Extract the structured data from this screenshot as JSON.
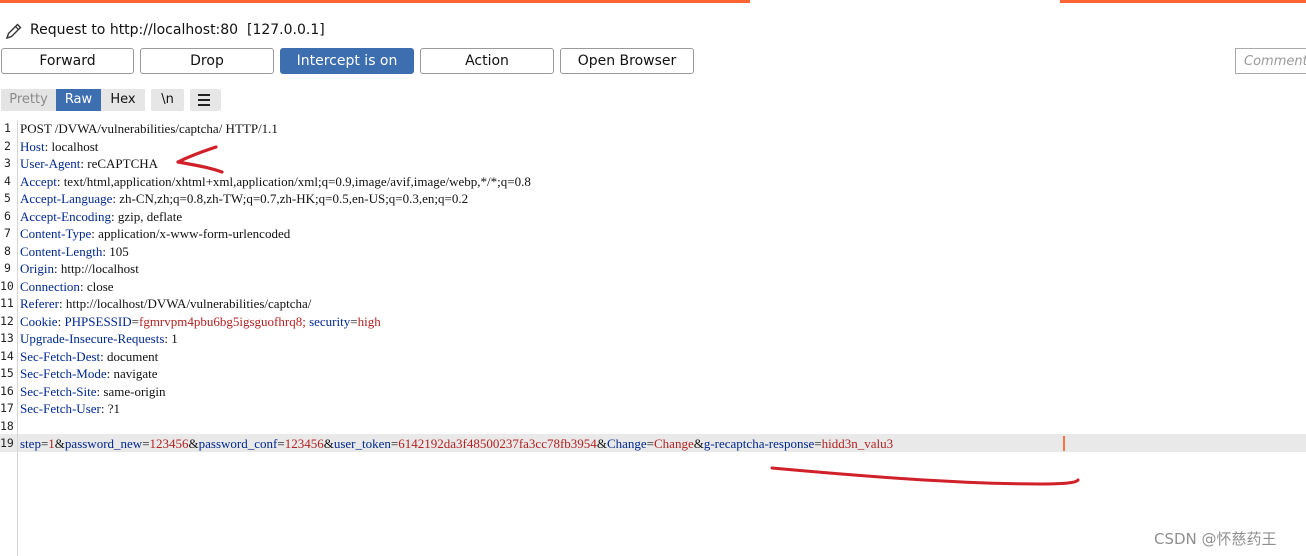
{
  "title": "Request to http://localhost:80  [127.0.0.1]",
  "toolbar": {
    "buttons": [
      "Forward",
      "Drop",
      "Intercept is on",
      "Action",
      "Open Browser"
    ],
    "active_button": "Intercept is on",
    "comment_placeholder": "Comment"
  },
  "view_tabs": {
    "pretty": "Pretty",
    "raw": "Raw",
    "hex": "Hex",
    "newline": "\\n",
    "menu_icon": "hamburger-icon",
    "active": "Raw"
  },
  "colors": {
    "accent": "#3d6eb0",
    "header_key": "#00288f",
    "value_red": "#b22222",
    "annotation": "#d0202a",
    "tab_strip": "#ff6633"
  },
  "request": {
    "line_numbers": [
      "1",
      "2",
      "3",
      "4",
      "5",
      "6",
      "7",
      "8",
      "9",
      "10",
      "11",
      "12",
      "13",
      "14",
      "15",
      "16",
      "17",
      "18",
      "19"
    ],
    "request_line": "POST /DVWA/vulnerabilities/captcha/ HTTP/1.1",
    "headers": [
      {
        "key": "Host",
        "value": "localhost"
      },
      {
        "key": "User-Agent",
        "value": "reCAPTCHA"
      },
      {
        "key": "Accept",
        "value": "text/html,application/xhtml+xml,application/xml;q=0.9,image/avif,image/webp,*/*;q=0.8"
      },
      {
        "key": "Accept-Language",
        "value": "zh-CN,zh;q=0.8,zh-TW;q=0.7,zh-HK;q=0.5,en-US;q=0.3,en;q=0.2"
      },
      {
        "key": "Accept-Encoding",
        "value": "gzip, deflate"
      },
      {
        "key": "Content-Type",
        "value": "application/x-www-form-urlencoded"
      },
      {
        "key": "Content-Length",
        "value": "105"
      },
      {
        "key": "Origin",
        "value": "http://localhost"
      },
      {
        "key": "Connection",
        "value": "close"
      },
      {
        "key": "Referer",
        "value": "http://localhost/DVWA/vulnerabilities/captcha/"
      }
    ],
    "cookie": {
      "key": "Cookie",
      "phpsessid_name": "PHPSESSID",
      "phpsessid_value": "fgmrvpm4pbu6bg5igsguofhrq8",
      "security_name": "security",
      "security_value": "high"
    },
    "headers_after": [
      {
        "key": "Upgrade-Insecure-Requests",
        "value": "1"
      },
      {
        "key": "Sec-Fetch-Dest",
        "value": "document"
      },
      {
        "key": "Sec-Fetch-Mode",
        "value": "navigate"
      },
      {
        "key": "Sec-Fetch-Site",
        "value": "same-origin"
      },
      {
        "key": "Sec-Fetch-User",
        "value": "?1"
      }
    ],
    "body_params": [
      {
        "name": "step",
        "value": "1"
      },
      {
        "name": "password_new",
        "value": "123456"
      },
      {
        "name": "password_conf",
        "value": "123456"
      },
      {
        "name": "user_token",
        "value": "6142192da3f48500237fa3cc78fb3954"
      },
      {
        "name": "Change",
        "value": "Change"
      },
      {
        "name": "g-recaptcha-response",
        "value": "hidd3n_valu3"
      }
    ]
  },
  "watermark": "CSDN @怀慈药王"
}
